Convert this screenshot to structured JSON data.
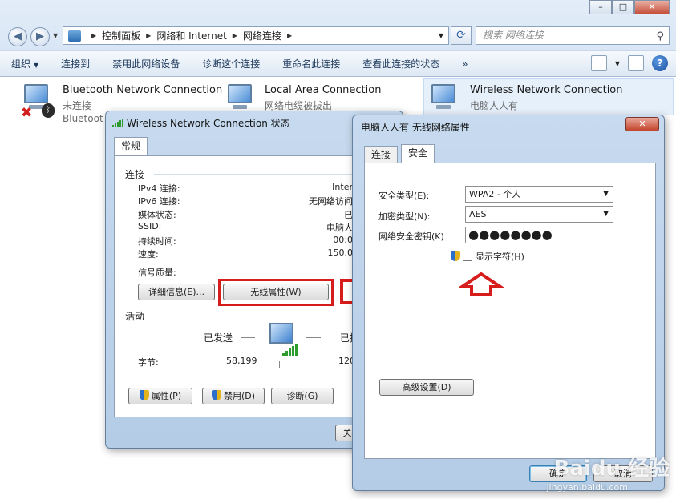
{
  "window": {
    "min": "–",
    "max": "□",
    "close": "✕"
  },
  "address": {
    "crumbs": [
      "控制面板",
      "网络和 Internet",
      "网络连接"
    ],
    "search_placeholder": "搜索 网络连接"
  },
  "toolbar": {
    "items": [
      "组织",
      "连接到",
      "禁用此网络设备",
      "诊断这个连接",
      "重命名此连接",
      "查看此连接的状态"
    ],
    "more": "»",
    "help": "?"
  },
  "connections": [
    {
      "title": "Bluetooth Network Connection",
      "status": "未连接",
      "device": "Bluetoot"
    },
    {
      "title": "Local Area Connection",
      "status": "网络电缆被拔出"
    },
    {
      "title": "Wireless Network Connection",
      "status": "电脑人人有"
    }
  ],
  "status_dialog": {
    "title": "Wireless Network Connection 状态",
    "tab": "常规",
    "section_connection": "连接",
    "rows": [
      {
        "label": "IPv4 连接:",
        "value": "Inter"
      },
      {
        "label": "IPv6 连接:",
        "value": "无网络访问"
      },
      {
        "label": "媒体状态:",
        "value": "已"
      },
      {
        "label": "SSID:",
        "value": "电脑人"
      },
      {
        "label": "持续时间:",
        "value": "00:0"
      },
      {
        "label": "速度:",
        "value": "150.0"
      }
    ],
    "signal_quality": "信号质量:",
    "details_btn": "详细信息(E)...",
    "wireless_props_btn": "无线属性(W)",
    "section_activity": "活动",
    "sent": "已发送",
    "received": "已接",
    "bytes_label": "字节:",
    "bytes_sent": "58,199",
    "bytes_received": "120,",
    "properties_btn": "属性(P)",
    "disable_btn": "禁用(D)",
    "diagnose_btn": "诊断(G)",
    "close_btn": "关"
  },
  "props_dialog": {
    "title": "电脑人人有 无线网络属性",
    "close": "✕",
    "tabs": [
      "连接",
      "安全"
    ],
    "security_type_label": "安全类型(E):",
    "security_type_value": "WPA2 - 个人",
    "encryption_label": "加密类型(N):",
    "encryption_value": "AES",
    "key_label": "网络安全密钥(K)",
    "key_value": "●●●●●●●●",
    "show_chars": "显示字符(H)",
    "advanced_btn": "高级设置(D)",
    "ok_btn": "确定",
    "cancel_btn": "取消"
  },
  "watermark": {
    "logo": "Baidu 经验",
    "url": "jingyan.baidu.com"
  },
  "colors": {
    "highlight_red": "#d71c1c",
    "dialog_frame": "#b4cce6",
    "link_blue": "#1e395b"
  }
}
